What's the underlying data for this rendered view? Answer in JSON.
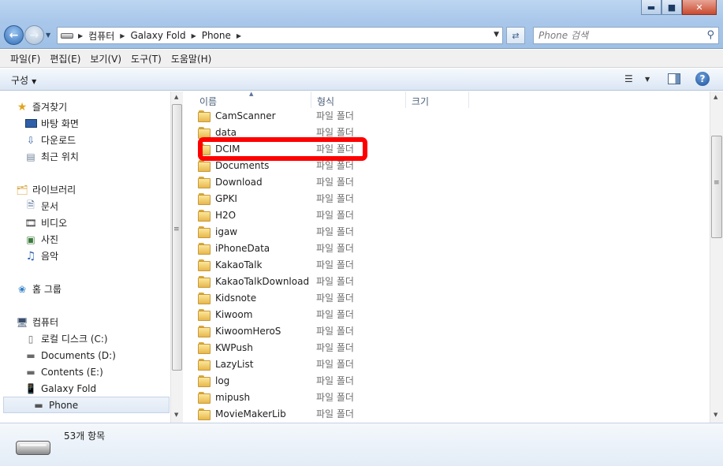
{
  "window": {
    "minimize": "▬",
    "maximize": "■",
    "close": "✕"
  },
  "address": {
    "crumbs": [
      "컴퓨터",
      "Galaxy Fold",
      "Phone"
    ]
  },
  "search": {
    "placeholder": "Phone 검색"
  },
  "menu": [
    "파일(F)",
    "편집(E)",
    "보기(V)",
    "도구(T)",
    "도움말(H)"
  ],
  "toolbar": {
    "organize": "구성"
  },
  "nav": {
    "favorites": "즐겨찾기",
    "desktop": "바탕 화면",
    "downloads": "다운로드",
    "recent": "최근 위치",
    "libraries": "라이브러리",
    "documents": "문서",
    "videos": "비디오",
    "pictures": "사진",
    "music": "음악",
    "homegroup": "홈 그룹",
    "computer": "컴퓨터",
    "drive_c": "로컬 디스크 (C:)",
    "drive_d": "Documents (D:)",
    "drive_e": "Contents (E:)",
    "galaxy_fold": "Galaxy Fold",
    "phone": "Phone"
  },
  "columns": {
    "name": "이름",
    "type": "형식",
    "size": "크기"
  },
  "files": [
    {
      "name": "CamScanner",
      "type": "파일 폴더"
    },
    {
      "name": "data",
      "type": "파일 폴더"
    },
    {
      "name": "DCIM",
      "type": "파일 폴더"
    },
    {
      "name": "Documents",
      "type": "파일 폴더"
    },
    {
      "name": "Download",
      "type": "파일 폴더"
    },
    {
      "name": "GPKI",
      "type": "파일 폴더"
    },
    {
      "name": "H2O",
      "type": "파일 폴더"
    },
    {
      "name": "igaw",
      "type": "파일 폴더"
    },
    {
      "name": "iPhoneData",
      "type": "파일 폴더"
    },
    {
      "name": "KakaoTalk",
      "type": "파일 폴더"
    },
    {
      "name": "KakaoTalkDownload",
      "type": "파일 폴더"
    },
    {
      "name": "Kidsnote",
      "type": "파일 폴더"
    },
    {
      "name": "Kiwoom",
      "type": "파일 폴더"
    },
    {
      "name": "KiwoomHeroS",
      "type": "파일 폴더"
    },
    {
      "name": "KWPush",
      "type": "파일 폴더"
    },
    {
      "name": "LazyList",
      "type": "파일 폴더"
    },
    {
      "name": "log",
      "type": "파일 폴더"
    },
    {
      "name": "mipush",
      "type": "파일 폴더"
    },
    {
      "name": "MovieMakerLib",
      "type": "파일 폴더"
    }
  ],
  "highlighted_file": "DCIM",
  "status": {
    "count": "53개 항목"
  }
}
